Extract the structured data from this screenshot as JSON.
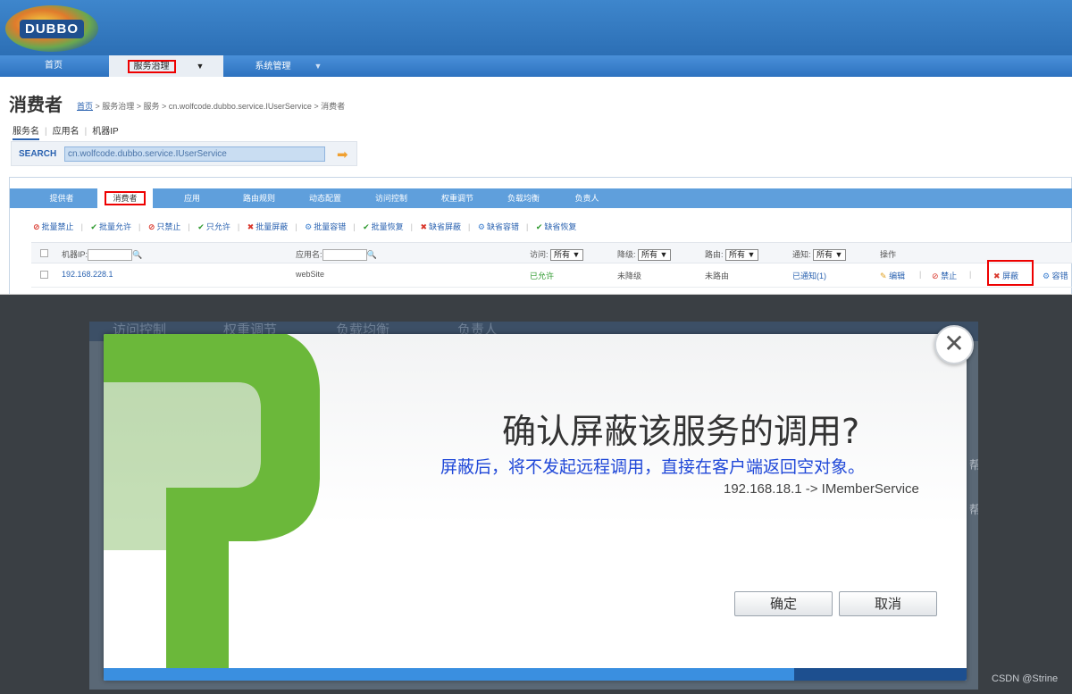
{
  "header": {
    "logo_text": "DUBBO"
  },
  "nav": {
    "items": [
      "首页",
      "服务治理",
      "系统管理"
    ]
  },
  "page": {
    "title": "消费者",
    "breadcrumb_home": "首页",
    "breadcrumb_rest": " > 服务治理 > 服务 > cn.wolfcode.dubbo.service.IUserService > 消费者",
    "subtabs": [
      "服务名",
      "应用名",
      "机器IP"
    ]
  },
  "search": {
    "label": "SEARCH",
    "value": "cn.wolfcode.dubbo.service.IUserService"
  },
  "tabs": [
    "提供者",
    "消费者",
    "应用",
    "路由规则",
    "动态配置",
    "访问控制",
    "权重调节",
    "负载均衡",
    "负责人"
  ],
  "actions": [
    {
      "icon": "ban-icon",
      "label": "批量禁止"
    },
    {
      "icon": "check-icon",
      "label": "批量允许"
    },
    {
      "icon": "ban-icon",
      "label": "只禁止"
    },
    {
      "icon": "check-icon",
      "label": "只允许"
    },
    {
      "icon": "block-icon",
      "label": "批量屏蔽"
    },
    {
      "icon": "gear-icon",
      "label": "批量容错"
    },
    {
      "icon": "check-icon",
      "label": "批量恢复"
    },
    {
      "icon": "block-icon",
      "label": "缺省屏蔽"
    },
    {
      "icon": "gear-icon",
      "label": "缺省容错"
    },
    {
      "icon": "check-icon",
      "label": "缺省恢复"
    }
  ],
  "table": {
    "headers": {
      "ip": "机器IP:",
      "app": "应用名:",
      "access": "访问:",
      "access_sel": "所有",
      "degrade": "降级:",
      "degrade_sel": "所有",
      "route": "路由:",
      "route_sel": "所有",
      "notify": "通知:",
      "notify_sel": "所有",
      "ops": "操作"
    },
    "rows": [
      {
        "ip": "192.168.228.1",
        "app": "webSite",
        "access": "已允许",
        "degrade": "未降级",
        "route": "未路由",
        "notify": "已通知(1)",
        "op_edit": "编辑",
        "op_ban": "禁止",
        "op_block": "屏蔽",
        "op_fault": "容错"
      }
    ]
  },
  "dialog": {
    "bg_tabs": [
      "访问控制",
      "权重调节",
      "负载均衡",
      "负责人"
    ],
    "title": "确认屏蔽该服务的调用?",
    "subtitle": "屏蔽后，将不发起远程调用，直接在客户端返回空对象。",
    "detail": "192.168.18.1 -> IMemberService",
    "confirm": "确定",
    "cancel": "取消",
    "close": "✕"
  },
  "watermark": "CSDN @Strine",
  "colors": {
    "accent": "#2d72bf",
    "highlight": "#e00000",
    "question_mark": "#6bb83a",
    "link": "#2a62b0"
  }
}
